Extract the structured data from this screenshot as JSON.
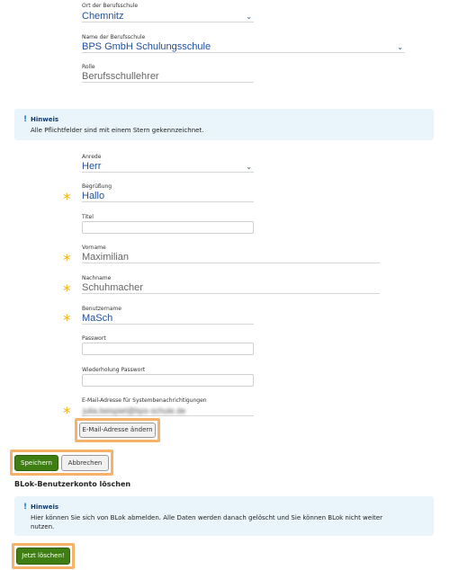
{
  "school": {
    "location_label": "Ort der Berufsschule",
    "location_value": "Chemnitz",
    "name_label": "Name der Berufsschule",
    "name_value": "BPS GmbH Schulungsschule",
    "role_label": "Rolle",
    "role_value": "Berufsschullehrer"
  },
  "notice_required": {
    "title": "Hinweis",
    "text": "Alle Pflichtfelder sind mit einem Stern gekennzeichnet."
  },
  "form": {
    "salutation_label": "Anrede",
    "salutation_value": "Herr",
    "greeting_label": "Begrüßung",
    "greeting_value": "Hallo",
    "title_label": "Titel",
    "title_value": "",
    "firstname_label": "Vorname",
    "firstname_value": "Maximilian",
    "lastname_label": "Nachname",
    "lastname_value": "Schuhmacher",
    "username_label": "Benutzername",
    "username_value": "MaSch",
    "password_label": "Passwort",
    "password_repeat_label": "Wiederholung Passwort",
    "email_label": "E-Mail-Adresse für Systembenachrichtigungen",
    "email_value": "julia.beispiel@bps-schule.de",
    "change_email_button": "E-Mail-Adresse ändern",
    "required_marker": "*"
  },
  "actions": {
    "save": "Speichern",
    "cancel": "Abbrechen"
  },
  "delete_section": {
    "title": "BLok-Benutzerkonto löschen",
    "notice_title": "Hinweis",
    "notice_line1": "Hier können Sie sich von BLok abmelden. Alle Daten werden danach gelöscht und Sie können BLok nicht weiter",
    "notice_line2": "nutzen.",
    "delete_button": "Jetzt löschen!"
  },
  "icons": {
    "select_caret": "chevron-down-icon",
    "notice": "info-exclamation-icon"
  },
  "colors": {
    "primary_green": "#3f7e12",
    "highlight_orange": "#f7b26a",
    "required_star": "#f4b400",
    "notice_bg": "#eaf5fb",
    "value_blue": "#1f4f9c"
  }
}
